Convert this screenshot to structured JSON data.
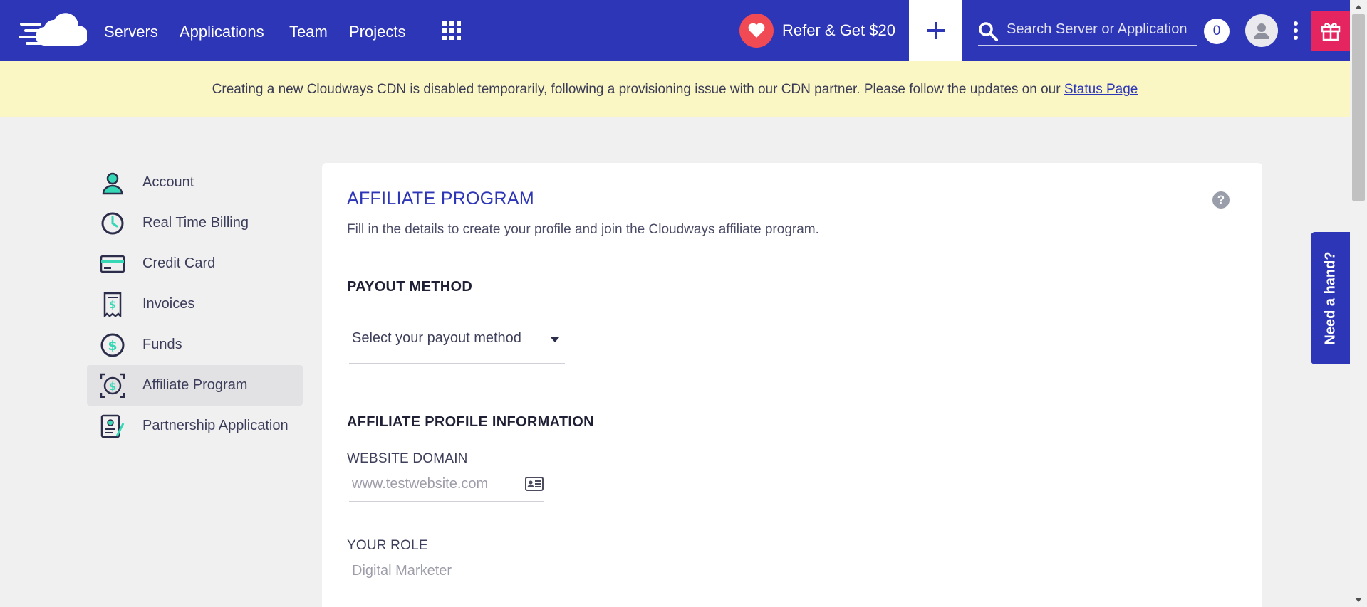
{
  "nav": {
    "links": [
      "Servers",
      "Applications",
      "Team",
      "Projects"
    ],
    "refer_label": "Refer & Get $20",
    "search_placeholder": "Search Server or Application",
    "notification_count": "0"
  },
  "notice": {
    "text": "Creating a new Cloudways CDN is disabled temporarily, following a provisioning issue with our CDN partner. Please follow the updates on our ",
    "link_label": "Status Page"
  },
  "sidebar": {
    "items": [
      {
        "label": "Account",
        "icon": "account-icon"
      },
      {
        "label": "Real Time Billing",
        "icon": "clock-icon"
      },
      {
        "label": "Credit Card",
        "icon": "credit-card-icon"
      },
      {
        "label": "Invoices",
        "icon": "invoice-icon"
      },
      {
        "label": "Funds",
        "icon": "dollar-icon"
      },
      {
        "label": "Affiliate Program",
        "icon": "affiliate-icon",
        "active": true
      },
      {
        "label": "Partnership Application",
        "icon": "partnership-icon"
      }
    ]
  },
  "main": {
    "title": "AFFILIATE PROGRAM",
    "subtitle": "Fill in the details to create your profile and join the Cloudways affiliate program.",
    "payout_heading": "PAYOUT METHOD",
    "payout_select": "Select your payout method",
    "profile_heading": "AFFILIATE PROFILE INFORMATION",
    "website_label": "WEBSITE DOMAIN",
    "website_placeholder": "www.testwebsite.com",
    "role_label": "YOUR ROLE",
    "role_placeholder": "Digital Marketer",
    "help_glyph": "?"
  },
  "help_tab": {
    "label": "Need a hand?"
  },
  "colors": {
    "brand": "#2e36b8",
    "notice_bg": "#fbf7c4",
    "refer_heart": "#f04a55",
    "gift": "#e5255f",
    "accent_green": "#35d7b4"
  }
}
